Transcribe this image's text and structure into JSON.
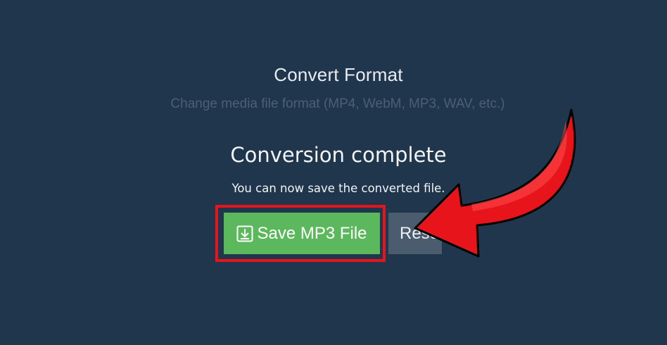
{
  "page": {
    "title": "Convert Format",
    "subtitle": "Change media file format (MP4, WebM, MP3, WAV, etc.)"
  },
  "result": {
    "heading": "Conversion complete",
    "message": "You can now save the converted file.",
    "save_label": "Save MP3 File",
    "reset_label": "Reset"
  },
  "icons": {
    "save": "download-icon",
    "annotation": "red-curved-arrow-icon"
  },
  "colors": {
    "background": "#20364d",
    "save_button": "#5cb85c",
    "reset_button": "#4b5c6e",
    "highlight": "#e8141b"
  }
}
